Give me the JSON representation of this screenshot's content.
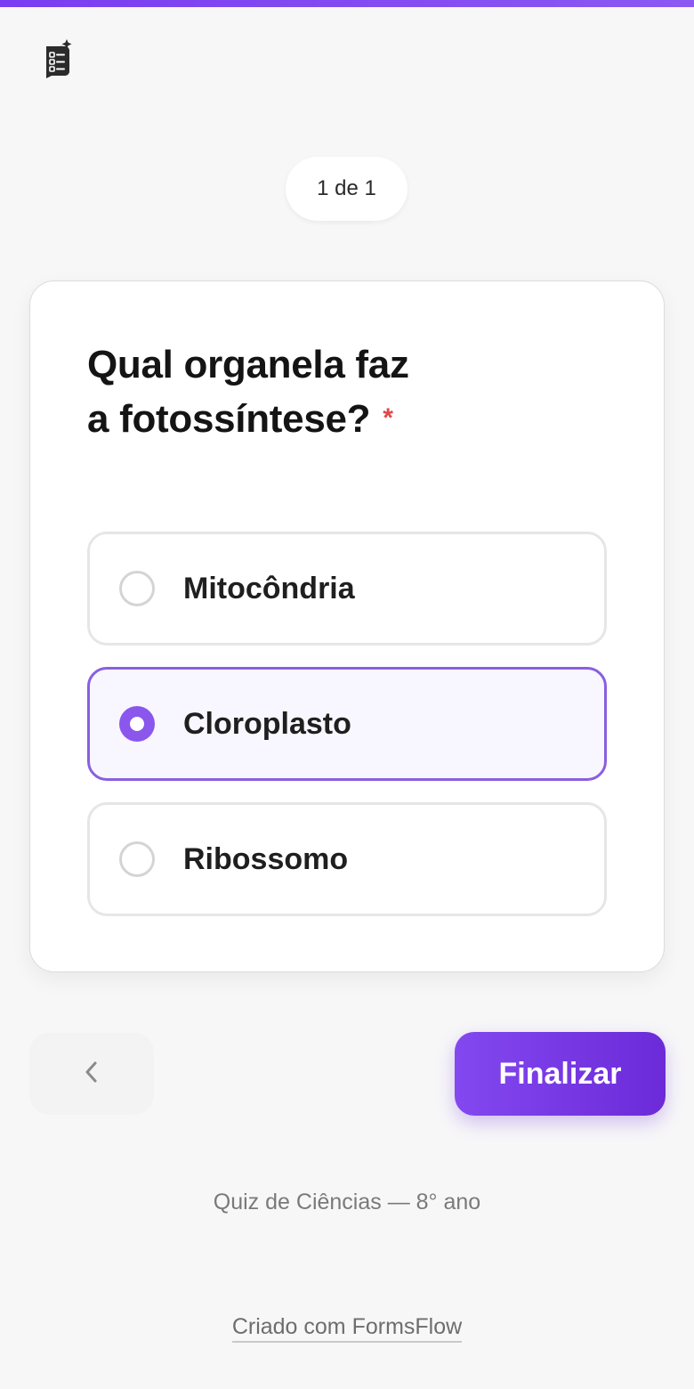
{
  "progress": {
    "text": "1 de 1"
  },
  "question": {
    "title_line1": "Qual organela faz",
    "title_line2": "a fotossíntese?",
    "required_marker": "*",
    "options": [
      {
        "label": "Mitocôndria",
        "selected": false
      },
      {
        "label": "Cloroplasto",
        "selected": true
      },
      {
        "label": "Ribossomo",
        "selected": false
      }
    ]
  },
  "navigation": {
    "back_icon": "chevron-left-icon",
    "finish_label": "Finalizar"
  },
  "footer": {
    "subtitle": "Quiz de Ciências — 8° ano",
    "branding": "Criado com FormsFlow"
  },
  "colors": {
    "accent": "#8b56ec",
    "button_gradient_start": "#8348f0",
    "button_gradient_end": "#6c2ad8",
    "required": "#e04848",
    "selected_background": "#f8f7ff"
  }
}
